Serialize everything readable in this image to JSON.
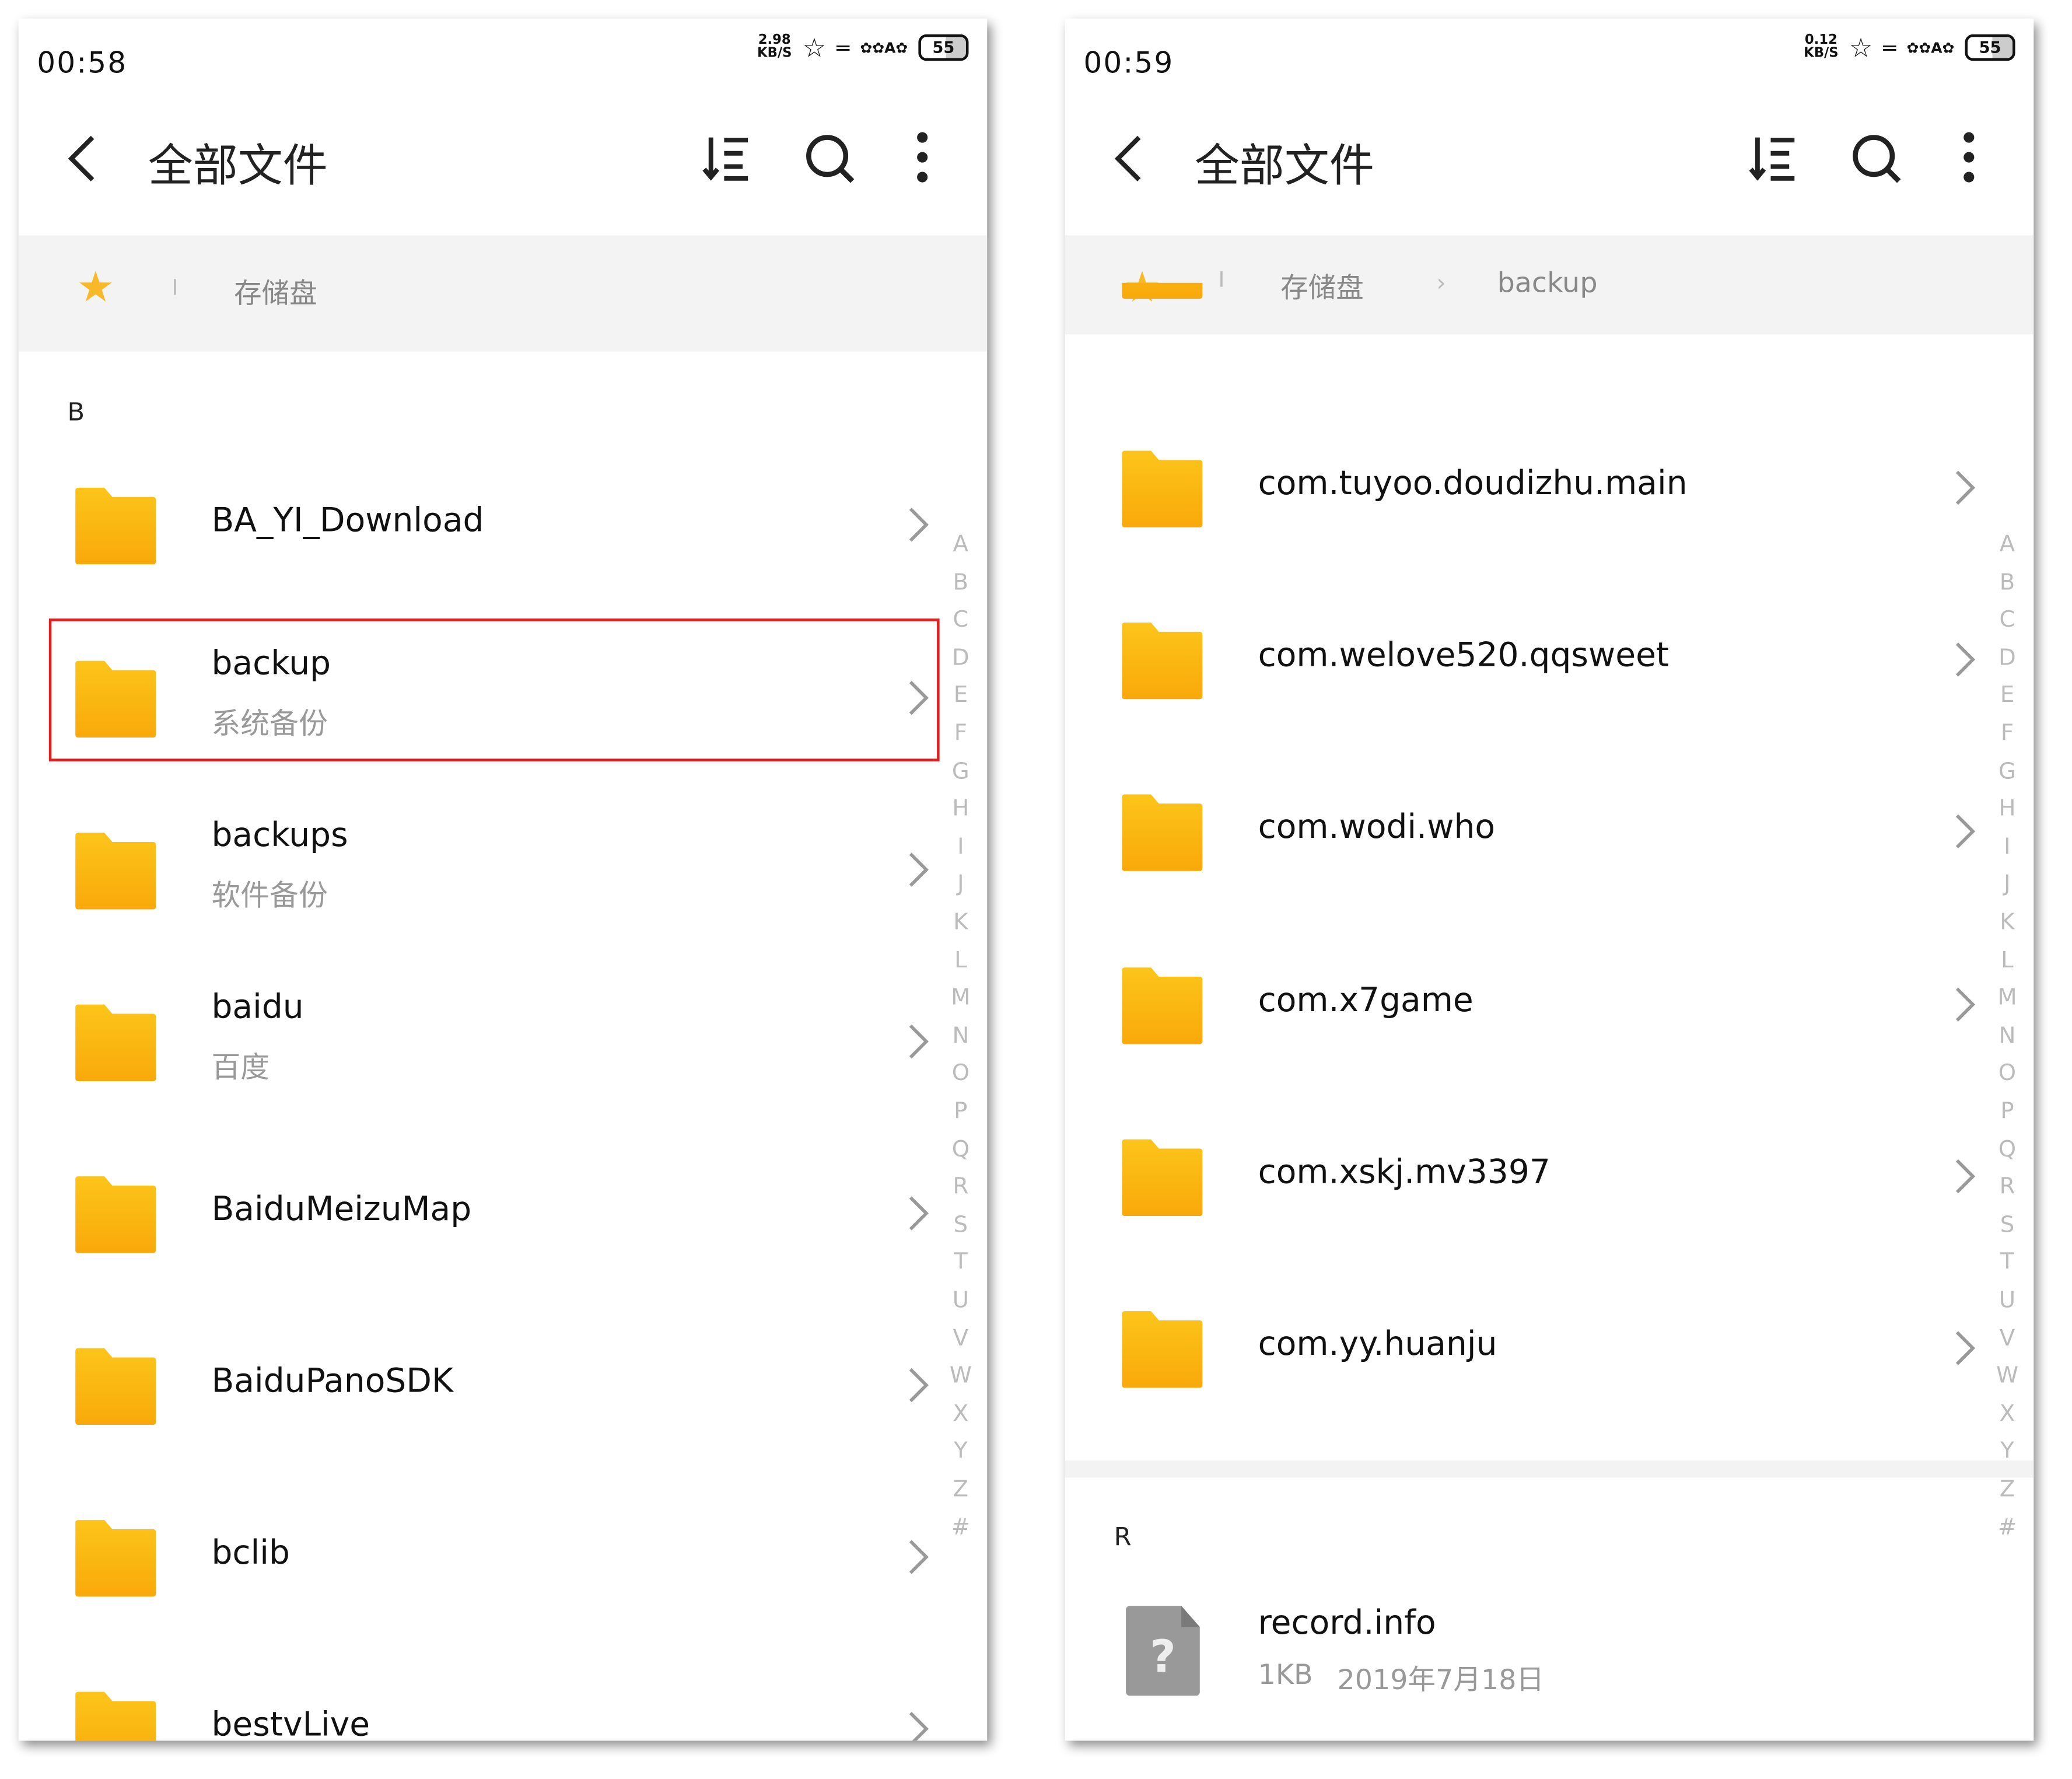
{
  "left": {
    "status": {
      "time": "00:58",
      "speed": "2.98",
      "speed_unit": "KB/S",
      "battery": "55"
    },
    "header": {
      "title": "全部文件"
    },
    "breadcrumb": {
      "sep": "I",
      "items": [
        "存储盘"
      ]
    },
    "section": "B",
    "rows": [
      {
        "name": "BA_YI_Download",
        "sub": ""
      },
      {
        "name": "backup",
        "sub": "系统备份"
      },
      {
        "name": "backups",
        "sub": "软件备份"
      },
      {
        "name": "baidu",
        "sub": "百度"
      },
      {
        "name": "BaiduMeizuMap",
        "sub": ""
      },
      {
        "name": "BaiduPanoSDK",
        "sub": ""
      },
      {
        "name": "bclib",
        "sub": ""
      },
      {
        "name": "bestvLive",
        "sub": ""
      }
    ]
  },
  "right": {
    "status": {
      "time": "00:59",
      "speed": "0.12",
      "speed_unit": "KB/S",
      "battery": "55"
    },
    "header": {
      "title": "全部文件"
    },
    "breadcrumb": {
      "sep": "I",
      "items": [
        "存储盘",
        "backup"
      ]
    },
    "rows": [
      {
        "name": "com.tuyoo.doudizhu.main",
        "sub": ""
      },
      {
        "name": "com.welove520.qqsweet",
        "sub": ""
      },
      {
        "name": "com.wodi.who",
        "sub": ""
      },
      {
        "name": "com.x7game",
        "sub": ""
      },
      {
        "name": "com.xskj.mv3397",
        "sub": ""
      },
      {
        "name": "com.yy.huanju",
        "sub": ""
      }
    ],
    "section": "R",
    "file": {
      "name": "record.info",
      "size": "1KB",
      "date": "2019年7月18日"
    }
  },
  "alphabet": [
    "A",
    "B",
    "C",
    "D",
    "E",
    "F",
    "G",
    "H",
    "I",
    "J",
    "K",
    "L",
    "M",
    "N",
    "O",
    "P",
    "Q",
    "R",
    "S",
    "T",
    "U",
    "V",
    "W",
    "X",
    "Y",
    "Z",
    "#"
  ],
  "colors": {
    "folder": "#fbb813",
    "star": "#f7b928",
    "highlight": "#e02020"
  }
}
